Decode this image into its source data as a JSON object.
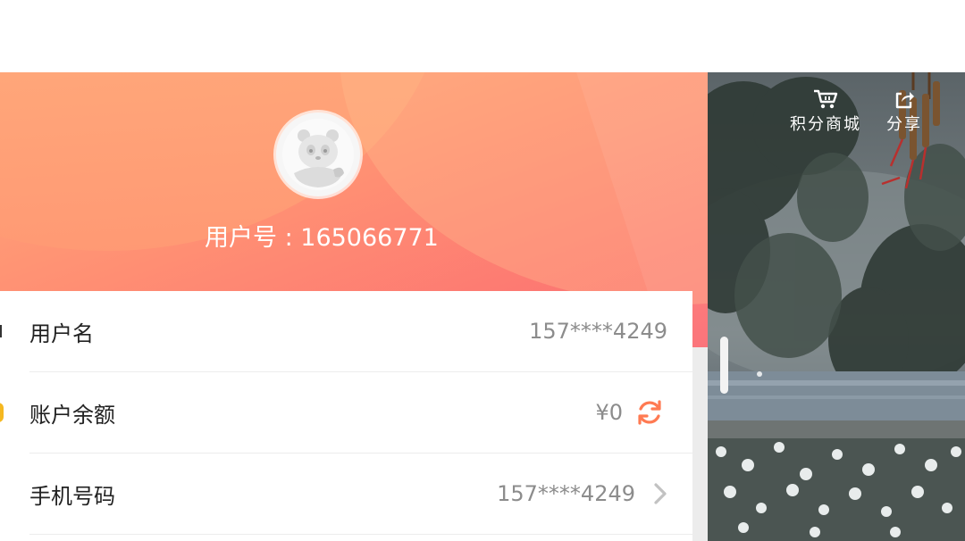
{
  "profile": {
    "user_id_text": "用户号 : 165066771"
  },
  "rows": [
    {
      "label": "用户名",
      "value": "157****4249"
    },
    {
      "label": "账户余额",
      "value": "¥0",
      "icon": "refresh-icon"
    },
    {
      "label": "手机号码",
      "value": "157****4249",
      "icon": "chevron-right-icon"
    }
  ],
  "scene": {
    "shop_label": "积分商城",
    "shop_icon": "cart-icon",
    "share_label": "分享",
    "share_icon": "share-icon"
  },
  "colors": {
    "accent": "#ff7a52",
    "hero_start": "#ffad7a",
    "hero_end": "#fb6a72"
  }
}
